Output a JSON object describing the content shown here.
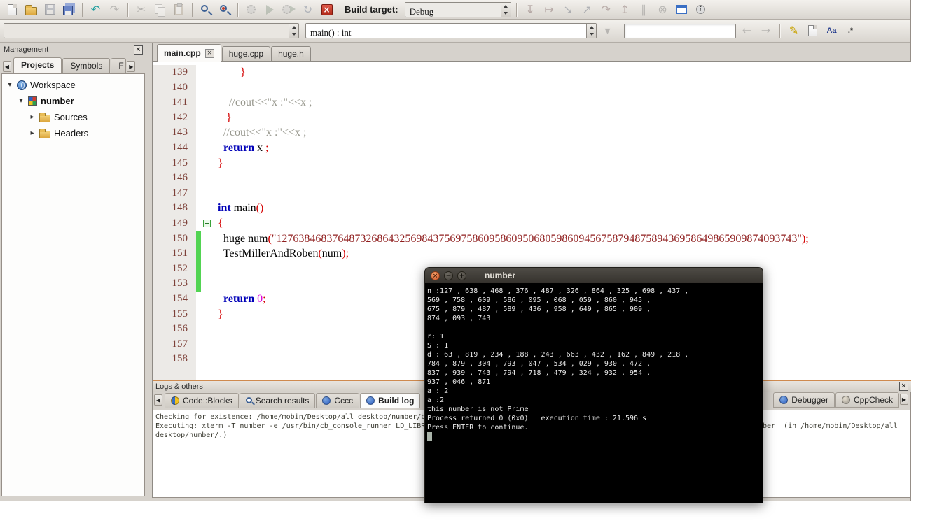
{
  "colors": {
    "chrome": "#d6d2cc",
    "splitter_accent": "#cf8a4e",
    "keyword": "#0000b8",
    "string": "#8f1d1d",
    "comment": "#98988e",
    "number_literal": "#dd00dd",
    "operator": "#d40000",
    "line_number": "#7d4038",
    "change_marker": "#52d452",
    "terminal_bg": "#000000",
    "terminal_fg": "#e8e8e8",
    "terminal_close_button": "#d0552a"
  },
  "toolbar_main": {
    "build_target_label": "Build target:",
    "build_target_value": "Debug",
    "file_icons": [
      {
        "name": "new-file-button",
        "kind": "page",
        "enabled": true
      },
      {
        "name": "open-file-button",
        "kind": "folder",
        "enabled": true
      },
      {
        "name": "save-button",
        "kind": "floppy",
        "enabled": false
      },
      {
        "name": "save-all-button",
        "kind": "floppy2",
        "enabled": true
      }
    ],
    "edit_icons": [
      {
        "name": "undo-button",
        "kind": "glyph",
        "glyph": "↶",
        "color": "#1d9e9e",
        "enabled": true
      },
      {
        "name": "redo-button",
        "kind": "glyph",
        "glyph": "↷",
        "color": "#6e6e6e",
        "enabled": false
      }
    ],
    "clipboard_icons": [
      {
        "name": "cut-button",
        "kind": "glyph",
        "glyph": "✂",
        "color": "#5c5c5c",
        "enabled": false
      },
      {
        "name": "copy-button",
        "kind": "copy",
        "enabled": false
      },
      {
        "name": "paste-button",
        "kind": "paste",
        "enabled": false
      }
    ],
    "search_icons": [
      {
        "name": "find-button",
        "kind": "mag",
        "enabled": true
      },
      {
        "name": "replace-button",
        "kind": "magr",
        "enabled": true
      }
    ],
    "build_icons": [
      {
        "name": "compile-button",
        "kind": "gear",
        "enabled": false
      },
      {
        "name": "run-button",
        "kind": "play",
        "enabled": false
      },
      {
        "name": "build-and-run-button",
        "kind": "buildrun",
        "enabled": false
      },
      {
        "name": "rebuild-button",
        "kind": "glyph",
        "glyph": "↻",
        "color": "#3a6fc4",
        "enabled": false
      },
      {
        "name": "abort-build-button",
        "kind": "stopred",
        "enabled": true
      }
    ],
    "debug_icons": [
      {
        "name": "debug-run-to-cursor-button",
        "kind": "glyph",
        "glyph": "↧",
        "color": "#a04040",
        "enabled": false
      },
      {
        "name": "debug-next-line-button",
        "kind": "glyph",
        "glyph": "↦",
        "color": "#a04040",
        "enabled": false
      },
      {
        "name": "debug-step-into-button",
        "kind": "glyph",
        "glyph": "↘",
        "color": "#40609a",
        "enabled": false
      },
      {
        "name": "debug-step-out-button",
        "kind": "glyph",
        "glyph": "↗",
        "color": "#40609a",
        "enabled": false
      },
      {
        "name": "debug-next-instruction-button",
        "kind": "glyph",
        "glyph": "↷",
        "color": "#a04040",
        "enabled": false
      },
      {
        "name": "debug-step-into-instruction-button",
        "kind": "glyph",
        "glyph": "↥",
        "color": "#a04040",
        "enabled": false
      },
      {
        "name": "debug-break-button",
        "kind": "glyph",
        "glyph": "∥",
        "color": "#6e6e6e",
        "enabled": false
      },
      {
        "name": "debug-stop-button",
        "kind": "glyph",
        "glyph": "⊗",
        "color": "#6e6e6e",
        "enabled": false
      },
      {
        "name": "debugging-windows-button",
        "kind": "window",
        "enabled": true
      },
      {
        "name": "various-info-button",
        "kind": "info",
        "enabled": true
      }
    ]
  },
  "toolbar_code": {
    "compiler_value": "",
    "scope_value": "main() : int",
    "search_value": "",
    "search_placeholder": "",
    "mid_icons": [
      {
        "name": "incremental-search-options-button",
        "kind": "glyph",
        "glyph": "▾",
        "color": "#6e6e6e",
        "enabled": false
      }
    ],
    "nav_icons": [
      {
        "name": "goto-previous-changed-line-button",
        "kind": "glyph",
        "glyph": "←",
        "color": "#6e6e6e",
        "enabled": false
      },
      {
        "name": "goto-next-changed-line-button",
        "kind": "glyph",
        "glyph": "→",
        "color": "#6e6e6e",
        "enabled": false
      }
    ],
    "right_icons": [
      {
        "name": "highlight-occurrences-button",
        "kind": "glyph",
        "glyph": "✎",
        "color": "#c8a200",
        "enabled": true
      },
      {
        "name": "selected-text-button",
        "kind": "page",
        "enabled": true
      },
      {
        "name": "match-case-button",
        "kind": "text",
        "glyph": "Aa",
        "color": "#223a8c",
        "enabled": true
      },
      {
        "name": "regex-button",
        "kind": "text",
        "glyph": ".*",
        "color": "#222222",
        "enabled": true
      }
    ]
  },
  "management": {
    "title": "Management",
    "tabs": [
      {
        "label": "Projects",
        "active": true
      },
      {
        "label": "Symbols",
        "active": false
      },
      {
        "label": "F",
        "active": false
      }
    ],
    "tree": [
      {
        "label": "Workspace",
        "icon": "workspace-globe-icon",
        "level": 0,
        "expander": "open",
        "bold": false
      },
      {
        "label": "number",
        "icon": "project-icon",
        "level": 1,
        "expander": "open",
        "bold": true
      },
      {
        "label": "Sources",
        "icon": "folder-icon",
        "level": 2,
        "expander": "closed",
        "bold": false
      },
      {
        "label": "Headers",
        "icon": "folder-icon",
        "level": 2,
        "expander": "closed",
        "bold": false
      }
    ]
  },
  "editor": {
    "tabs": [
      {
        "label": "main.cpp",
        "active": true,
        "closable": true
      },
      {
        "label": "huge.cpp",
        "active": false,
        "closable": false
      },
      {
        "label": "huge.h",
        "active": false,
        "closable": false
      }
    ],
    "lines": [
      {
        "num": 139,
        "seg": [
          {
            "s": "p",
            "t": "        "
          },
          {
            "s": "o",
            "t": "}"
          }
        ]
      },
      {
        "num": 140,
        "seg": []
      },
      {
        "num": 141,
        "seg": [
          {
            "s": "p",
            "t": "    "
          },
          {
            "s": "c",
            "t": "//cout<<\"x :\"<<x ;"
          }
        ]
      },
      {
        "num": 142,
        "seg": [
          {
            "s": "p",
            "t": "   "
          },
          {
            "s": "o",
            "t": "}"
          }
        ]
      },
      {
        "num": 143,
        "seg": [
          {
            "s": "p",
            "t": "  "
          },
          {
            "s": "c",
            "t": "//cout<<\"x :\"<<x ;"
          }
        ]
      },
      {
        "num": 144,
        "seg": [
          {
            "s": "p",
            "t": "  "
          },
          {
            "s": "k",
            "t": "return"
          },
          {
            "s": "p",
            "t": " x "
          },
          {
            "s": "o",
            "t": ";"
          }
        ]
      },
      {
        "num": 145,
        "seg": [
          {
            "s": "o",
            "t": "}"
          }
        ]
      },
      {
        "num": 146,
        "seg": []
      },
      {
        "num": 147,
        "seg": []
      },
      {
        "num": 148,
        "seg": [
          {
            "s": "k",
            "t": "int"
          },
          {
            "s": "p",
            "t": " main"
          },
          {
            "s": "o",
            "t": "()"
          }
        ]
      },
      {
        "num": 149,
        "fold": true,
        "seg": [
          {
            "s": "o",
            "t": "{"
          }
        ]
      },
      {
        "num": 150,
        "changed": true,
        "seg": [
          {
            "s": "p",
            "t": "  huge num"
          },
          {
            "s": "o",
            "t": "("
          },
          {
            "s": "s",
            "t": "\"127638468376487326864325698437569758609586095068059860945675879487589436958649865909874093743\""
          },
          {
            "s": "o",
            "t": ");"
          }
        ]
      },
      {
        "num": 151,
        "changed": true,
        "seg": [
          {
            "s": "p",
            "t": "  TestMillerAndRoben"
          },
          {
            "s": "o",
            "t": "("
          },
          {
            "s": "p",
            "t": "num"
          },
          {
            "s": "o",
            "t": ");"
          }
        ]
      },
      {
        "num": 152,
        "changed": true,
        "seg": []
      },
      {
        "num": 153,
        "changed": true,
        "seg": []
      },
      {
        "num": 154,
        "seg": [
          {
            "s": "p",
            "t": "  "
          },
          {
            "s": "k",
            "t": "return"
          },
          {
            "s": "p",
            "t": " "
          },
          {
            "s": "n",
            "t": "0"
          },
          {
            "s": "o",
            "t": ";"
          }
        ]
      },
      {
        "num": 155,
        "seg": [
          {
            "s": "o",
            "t": "}"
          }
        ]
      },
      {
        "num": 156,
        "seg": []
      },
      {
        "num": 157,
        "seg": []
      },
      {
        "num": 158,
        "seg": []
      }
    ]
  },
  "terminal": {
    "title": "number",
    "lines": [
      "n :127 , 638 , 468 , 376 , 487 , 326 , 864 , 325 , 698 , 437 ,",
      "569 , 758 , 609 , 586 , 095 , 068 , 059 , 860 , 945 ,",
      "675 , 879 , 487 , 589 , 436 , 958 , 649 , 865 , 909 ,",
      "874 , 093 , 743",
      "",
      "r: 1",
      "S : 1",
      "d : 63 , 819 , 234 , 188 , 243 , 663 , 432 , 162 , 849 , 218 ,",
      "784 , 879 , 304 , 793 , 047 , 534 , 029 , 930 , 472 ,",
      "837 , 939 , 743 , 794 , 718 , 479 , 324 , 932 , 954 ,",
      "937 , 046 , 871",
      "a : 2",
      "a :2",
      "this number is not Prime",
      "Process returned 0 (0x0)   execution time : 21.596 s",
      "Press ENTER to continue."
    ],
    "cursor": true
  },
  "logs": {
    "title": "Logs & others",
    "tabs_left": [
      {
        "label": "Code::Blocks",
        "icon": "codeblocks",
        "active": false
      },
      {
        "label": "Search results",
        "icon": "search",
        "active": false
      },
      {
        "label": "Cccc",
        "icon": "blue",
        "active": false
      },
      {
        "label": "Build log",
        "icon": "blue",
        "active": true
      }
    ],
    "tabs_right": [
      {
        "label": "Debugger",
        "icon": "blue",
        "active": false
      },
      {
        "label": "CppCheck",
        "icon": "check",
        "active": false
      }
    ],
    "lines": [
      "Checking for existence: /home/mobin/Desktop/all desktop/number/bin/Debug/number",
      "Executing: xterm -T number -e /usr/bin/cb_console_runner LD_LIBRARY_PATH=$LD_LIBRARY_PATH:. /home/mobin/Desktop/all desktop/number/bin/Debug/number  (in /home/mobin/Desktop/all",
      "desktop/number/.)"
    ]
  }
}
